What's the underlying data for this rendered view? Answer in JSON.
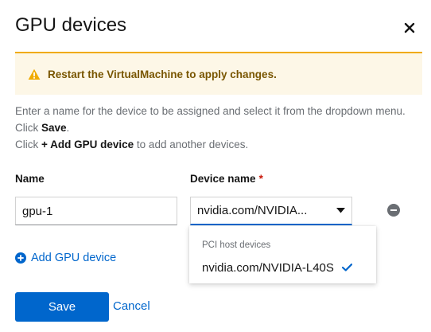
{
  "modal": {
    "title": "GPU devices"
  },
  "alert": {
    "text": "Restart the VirtualMachine to apply changes.",
    "color": "#f0ab00"
  },
  "help": {
    "line1": "Enter a name for the device to be assigned and select it from the dropdown menu.",
    "line2_prefix": "Click ",
    "line2_bold": "Save",
    "line2_suffix": ".",
    "line3_prefix": "Click ",
    "line3_bold": "+ Add GPU device",
    "line3_suffix": " to add another devices."
  },
  "form": {
    "name_label": "Name",
    "device_label": "Device name",
    "required_mark": "*",
    "name_value": "gpu-1",
    "device_value": "nvidia.com/NVIDIA..."
  },
  "dropdown": {
    "group_label": "PCI host devices",
    "items": [
      {
        "label": "nvidia.com/NVIDIA-L40S",
        "selected": true
      }
    ]
  },
  "actions": {
    "add_label": "Add GPU device",
    "save_label": "Save",
    "cancel_label": "Cancel"
  },
  "colors": {
    "primary": "#0066cc",
    "warning": "#f0ab00",
    "warning_bg": "#fdf7e7",
    "warning_text": "#795600",
    "danger": "#c9190b"
  }
}
